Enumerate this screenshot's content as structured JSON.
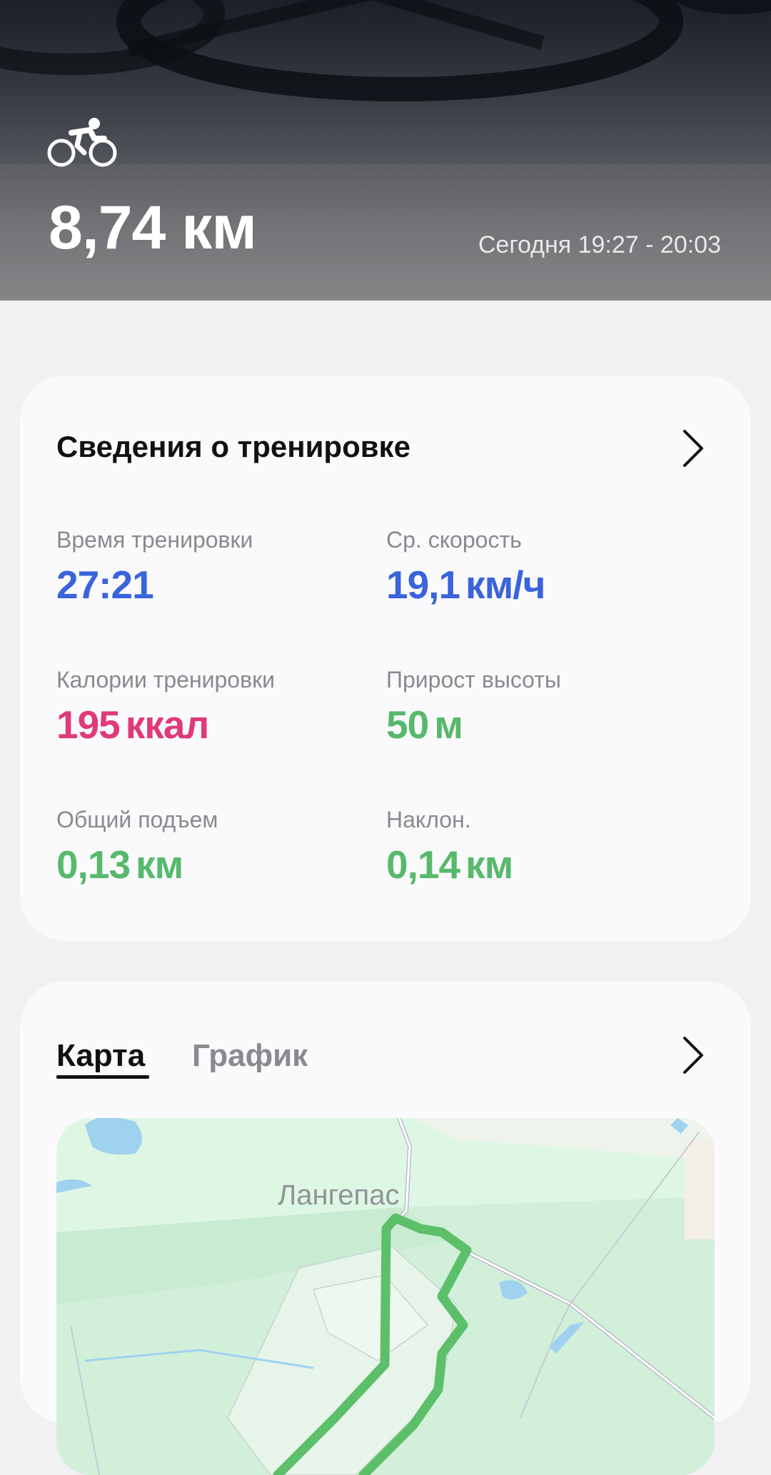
{
  "hero": {
    "distance": "8,74 км",
    "date_range": "Сегодня 19:27 - 20:03",
    "activity_icon": "cycling-icon"
  },
  "details": {
    "title": "Сведения о тренировке",
    "metrics": [
      {
        "label": "Время тренировки",
        "value": "27:21",
        "unit": "",
        "color": "#3a63dc"
      },
      {
        "label": "Ср. скорость",
        "value": "19,1",
        "unit": "км/ч",
        "color": "#3a63dc"
      },
      {
        "label": "Калории тренировки",
        "value": "195",
        "unit": "ккал",
        "color": "#e03a77"
      },
      {
        "label": "Прирост высоты",
        "value": "50",
        "unit": "м",
        "color": "#57b96b"
      },
      {
        "label": "Общий подъем",
        "value": "0,13",
        "unit": "км",
        "color": "#57b96b"
      },
      {
        "label": "Наклон.",
        "value": "0,14",
        "unit": "км",
        "color": "#57b96b"
      }
    ]
  },
  "map_card": {
    "tabs": [
      {
        "label": "Карта",
        "active": true
      },
      {
        "label": "График",
        "active": false
      }
    ],
    "map_label": "Лангепас",
    "route_color": "#5cbf6a"
  }
}
